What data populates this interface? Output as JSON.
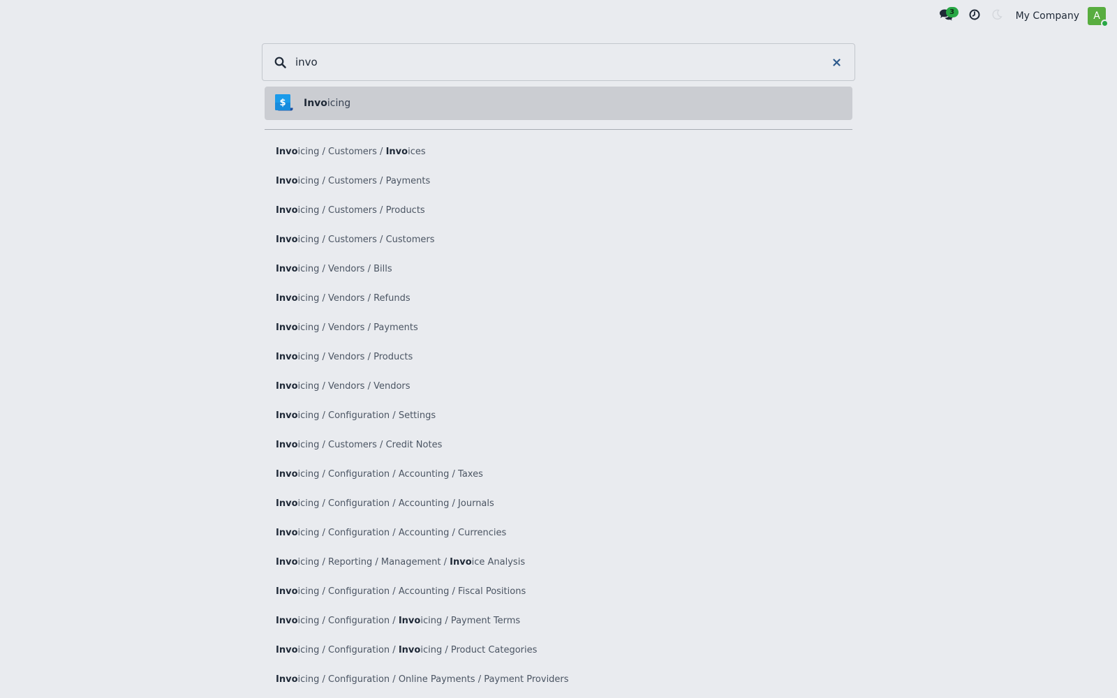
{
  "topbar": {
    "messages_badge": "3",
    "icons": {
      "messages": "chat-bubbles-icon",
      "activity": "clock-icon",
      "theme": "moon-icon"
    },
    "company_name": "My Company",
    "avatar_initial": "A",
    "avatar_color": "#58ad3f",
    "status_color": "#28a745"
  },
  "search": {
    "query": "invo",
    "search_icon": "search-icon",
    "clear_icon": "close-icon"
  },
  "app_result": {
    "icon": "invoicing-app-icon",
    "label_match": "Invo",
    "label_rest": "icing"
  },
  "menu_results": [
    [
      {
        "t": "Invo",
        "m": true
      },
      {
        "t": "icing / Customers / "
      },
      {
        "t": "Invo",
        "m": true
      },
      {
        "t": "ices"
      }
    ],
    [
      {
        "t": "Invo",
        "m": true
      },
      {
        "t": "icing / Customers / Payments"
      }
    ],
    [
      {
        "t": "Invo",
        "m": true
      },
      {
        "t": "icing / Customers / Products"
      }
    ],
    [
      {
        "t": "Invo",
        "m": true
      },
      {
        "t": "icing / Customers / Customers"
      }
    ],
    [
      {
        "t": "Invo",
        "m": true
      },
      {
        "t": "icing / Vendors / Bills"
      }
    ],
    [
      {
        "t": "Invo",
        "m": true
      },
      {
        "t": "icing / Vendors / Refunds"
      }
    ],
    [
      {
        "t": "Invo",
        "m": true
      },
      {
        "t": "icing / Vendors / Payments"
      }
    ],
    [
      {
        "t": "Invo",
        "m": true
      },
      {
        "t": "icing / Vendors / Products"
      }
    ],
    [
      {
        "t": "Invo",
        "m": true
      },
      {
        "t": "icing / Vendors / Vendors"
      }
    ],
    [
      {
        "t": "Invo",
        "m": true
      },
      {
        "t": "icing / Configuration / Settings"
      }
    ],
    [
      {
        "t": "Invo",
        "m": true
      },
      {
        "t": "icing / Customers / Credit Notes"
      }
    ],
    [
      {
        "t": "Invo",
        "m": true
      },
      {
        "t": "icing / Configuration / Accounting / Taxes"
      }
    ],
    [
      {
        "t": "Invo",
        "m": true
      },
      {
        "t": "icing / Configuration / Accounting / Journals"
      }
    ],
    [
      {
        "t": "Invo",
        "m": true
      },
      {
        "t": "icing / Configuration / Accounting / Currencies"
      }
    ],
    [
      {
        "t": "Invo",
        "m": true
      },
      {
        "t": "icing / Reporting / Management / "
      },
      {
        "t": "Invo",
        "m": true
      },
      {
        "t": "ice Analysis"
      }
    ],
    [
      {
        "t": "Invo",
        "m": true
      },
      {
        "t": "icing / Configuration / Accounting / Fiscal Positions"
      }
    ],
    [
      {
        "t": "Invo",
        "m": true
      },
      {
        "t": "icing / Configuration / "
      },
      {
        "t": "Invo",
        "m": true
      },
      {
        "t": "icing / Payment Terms"
      }
    ],
    [
      {
        "t": "Invo",
        "m": true
      },
      {
        "t": "icing / Configuration / "
      },
      {
        "t": "Invo",
        "m": true
      },
      {
        "t": "icing / Product Categories"
      }
    ],
    [
      {
        "t": "Invo",
        "m": true
      },
      {
        "t": "icing / Configuration / Online Payments / Payment Providers"
      }
    ]
  ]
}
